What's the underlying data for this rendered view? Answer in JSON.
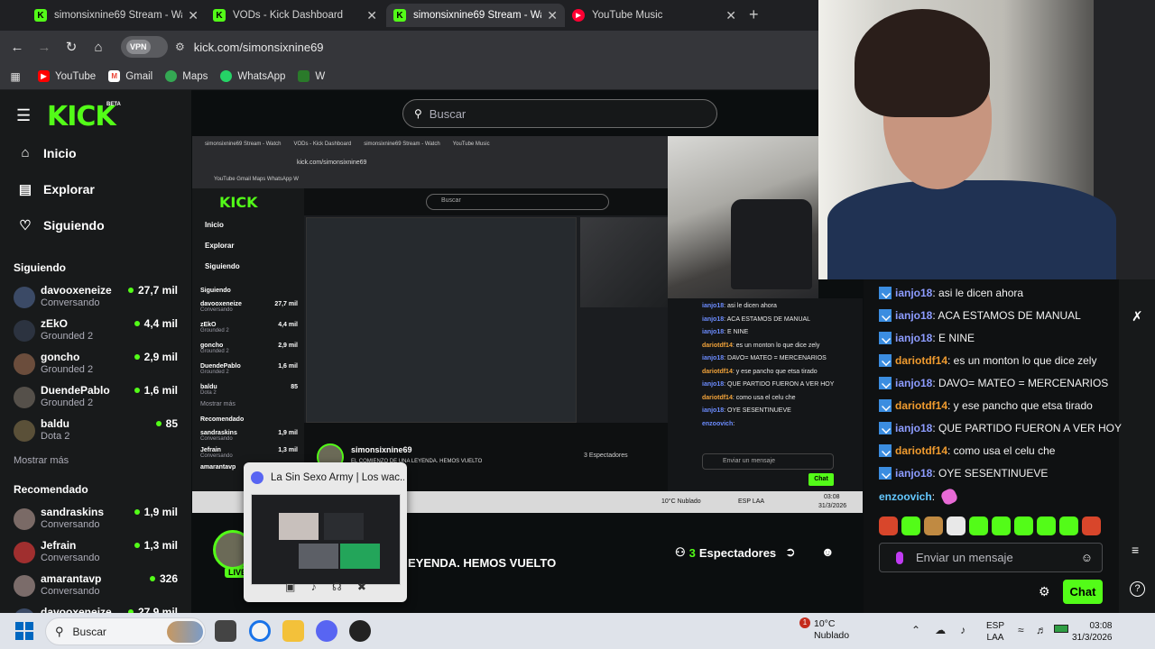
{
  "browser": {
    "tabs": [
      {
        "title": "simonsixnine69 Stream - Watch",
        "icon": "kick-icon"
      },
      {
        "title": "VODs - Kick Dashboard",
        "icon": "kick-icon"
      },
      {
        "title": "simonsixnine69 Stream - Watch",
        "icon": "kick-icon",
        "active": true
      },
      {
        "title": "YouTube Music",
        "icon": "youtube-music-icon"
      }
    ],
    "vpn_label": "VPN",
    "url": "kick.com/simonsixnine69",
    "bookmarks": [
      "YouTube",
      "Gmail",
      "Maps",
      "WhatsApp",
      "W"
    ]
  },
  "kick": {
    "logo": "KICK",
    "beta": "BETA",
    "search_placeholder": "Buscar",
    "nav": [
      "Inicio",
      "Explorar",
      "Siguiendo"
    ],
    "following_header": "Siguiendo",
    "following": [
      {
        "name": "davooxeneize",
        "category": "Conversando",
        "viewers": "27,7 mil"
      },
      {
        "name": "zEkO",
        "category": "Grounded 2",
        "viewers": "4,4 mil"
      },
      {
        "name": "goncho",
        "category": "Grounded 2",
        "viewers": "2,9 mil"
      },
      {
        "name": "DuendePablo",
        "category": "Grounded 2",
        "viewers": "1,6 mil"
      },
      {
        "name": "baldu",
        "category": "Dota 2",
        "viewers": "85"
      }
    ],
    "show_more": "Mostrar más",
    "recommended_header": "Recomendado",
    "recommended": [
      {
        "name": "sandraskins",
        "category": "Conversando",
        "viewers": "1,9 mil"
      },
      {
        "name": "Jefrain",
        "category": "Conversando",
        "viewers": "1,3 mil"
      },
      {
        "name": "amarantavp",
        "category": "Conversando",
        "viewers": "326"
      },
      {
        "name": "davooxeneize",
        "category": "",
        "viewers": "27,9 mil"
      }
    ],
    "stream": {
      "live": "LIVE",
      "title_fragment": "EYENDA. HEMOS VUELTO",
      "viewer_count": "3",
      "viewer_label": "Espectadores"
    },
    "chat": {
      "messages": [
        {
          "user": "ianjo18",
          "text": ": asi le dicen ahora"
        },
        {
          "user": "ianjo18",
          "text": ": ACA ESTAMOS DE MANUAL"
        },
        {
          "user": "ianjo18",
          "text": ": E NINE"
        },
        {
          "user": "dariotdf14",
          "text": ": es un monton lo que dice zely"
        },
        {
          "user": "ianjo18",
          "text": ": DAVO= MATEO = MERCENARIOS"
        },
        {
          "user": "dariotdf14",
          "text": ": y ese pancho que etsa tirado"
        },
        {
          "user": "ianjo18",
          "text": ": QUE PARTIDO FUERON A VER HOY"
        },
        {
          "user": "dariotdf14",
          "text": ": como usa el celu che"
        },
        {
          "user": "ianjo18",
          "text": ": OYE SESENTINUEVE"
        },
        {
          "user": "enzoovich",
          "text": ":"
        }
      ],
      "input_placeholder": "Enviar un mensaje",
      "chat_button": "Chat"
    }
  },
  "nested": {
    "tabs": [
      "simonsixnine69 Stream - Watch",
      "VODs - Kick Dashboard",
      "simonsixnine69 Stream - Watch",
      "YouTube Music"
    ],
    "url": "kick.com/simonsixnine69",
    "bookmarks": "YouTube   Gmail   Maps   WhatsApp   W",
    "logo": "KICK",
    "search": "Buscar",
    "nav": [
      "Inicio",
      "Explorar",
      "Siguiendo"
    ],
    "following_header": "Siguiendo",
    "following": [
      {
        "name": "davooxeneize",
        "category": "Conversando",
        "viewers": "27,7 mil"
      },
      {
        "name": "zEkO",
        "category": "Grounded 2",
        "viewers": "4,4 mil"
      },
      {
        "name": "goncho",
        "category": "Grounded 2",
        "viewers": "2,9 mil"
      },
      {
        "name": "DuendePablo",
        "category": "Grounded 2",
        "viewers": "1,6 mil"
      },
      {
        "name": "baldu",
        "category": "Dota 2",
        "viewers": "85"
      }
    ],
    "show_more": "Mostrar más",
    "recommended_header": "Recomendado",
    "recommended": [
      {
        "name": "sandraskins",
        "category": "Conversando",
        "viewers": "1,9 mil"
      },
      {
        "name": "Jefrain",
        "category": "Conversando",
        "viewers": "1,3 mil"
      },
      {
        "name": "amarantavp",
        "category": "",
        "viewers": ""
      }
    ],
    "streamer": "simonsixnine69",
    "stream_title": "EL COMIENZO DE UNA LEYENDA. HEMOS VUELTO",
    "viewers": "3 Espectadores",
    "chat": [
      {
        "user": "ianjo18",
        "text": ": asi le dicen ahora"
      },
      {
        "user": "ianjo18",
        "text": ": ACA ESTAMOS DE MANUAL"
      },
      {
        "user": "ianjo18",
        "text": ": E NINE"
      },
      {
        "user": "dariotdf14",
        "text": ": es un monton lo que dice zely"
      },
      {
        "user": "ianjo18",
        "text": ": DAVO= MATEO = MERCENARIOS"
      },
      {
        "user": "dariotdf14",
        "text": ": y ese pancho que etsa tirado"
      },
      {
        "user": "ianjo18",
        "text": ": QUE PARTIDO FUERON A VER HOY"
      },
      {
        "user": "dariotdf14",
        "text": ": como usa el celu che"
      },
      {
        "user": "ianjo18",
        "text": ": OYE SESENTINUEVE"
      },
      {
        "user": "enzoovich",
        "text": ":"
      }
    ],
    "chat_input": "Enviar un mensaje",
    "chat_button": "Chat",
    "taskbar_weather": "10°C Nublado",
    "taskbar_lang": "ESP LAA",
    "taskbar_time": "03:08",
    "taskbar_date": "31/3/2026"
  },
  "discord_popup": {
    "title": "La Sin Sexo Army | Los wac..."
  },
  "taskbar": {
    "search": "Buscar",
    "weather_temp": "10°C",
    "weather_desc": "Nublado",
    "weather_badge": "1",
    "lang_top": "ESP",
    "lang_bottom": "LAA",
    "time": "03:08",
    "date": "31/3/2026"
  },
  "colors": {
    "kick_green": "#53fc18",
    "sidebar_bg": "#181a1b",
    "page_bg": "#0b0e0f",
    "username_blue": "#8d9cff",
    "username_orange": "#ef9b2f"
  }
}
